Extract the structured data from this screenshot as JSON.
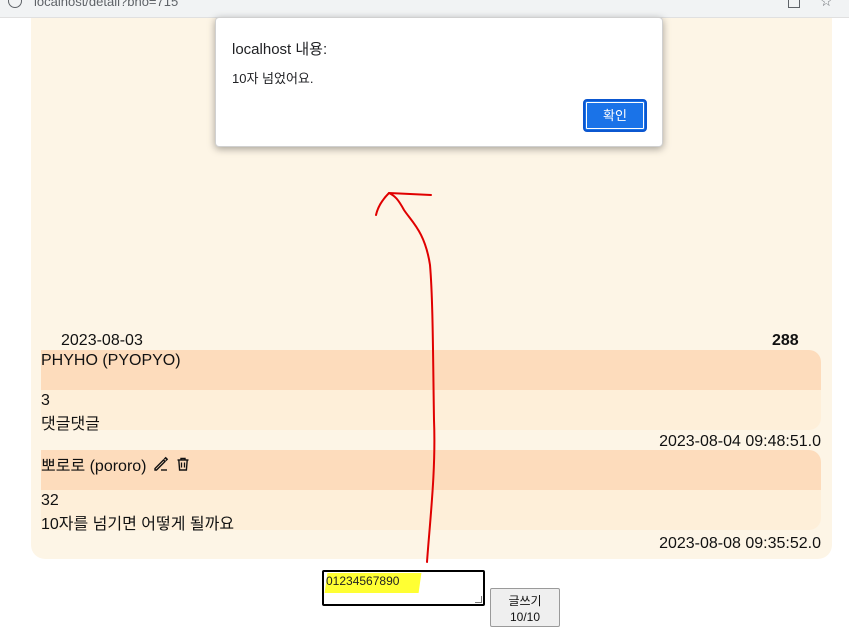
{
  "browser": {
    "url": "localhost/detail?bno=715"
  },
  "dialog": {
    "title": "localhost 내용:",
    "message": "10자 넘었어요.",
    "ok_label": "확인"
  },
  "post": {
    "date": "2023-08-03",
    "count": "288"
  },
  "comments": [
    {
      "author": "PHYHO (PYOPYO)",
      "number": "3",
      "text": "댓글댓글",
      "timestamp": "2023-08-04 09:48:51.0",
      "editable": false
    },
    {
      "author": "뽀로로 (pororo)",
      "number": "32",
      "text": "10자를 넘기면 어떻게 될까요",
      "timestamp": "2023-08-08 09:35:52.0",
      "editable": true
    }
  ],
  "comment_form": {
    "input_value": "01234567890",
    "submit_label": "글쓰기",
    "counter": "10/10"
  },
  "icons": {
    "edit": "edit-icon",
    "delete": "trash-icon"
  },
  "colors": {
    "card_bg": "#fdf5e6",
    "comment_head_bg": "#fddcbc",
    "comment_body_bg": "#feefd9",
    "dialog_ok": "#1a73e8",
    "annotation": "#e00000",
    "highlight": "#ffff33"
  }
}
